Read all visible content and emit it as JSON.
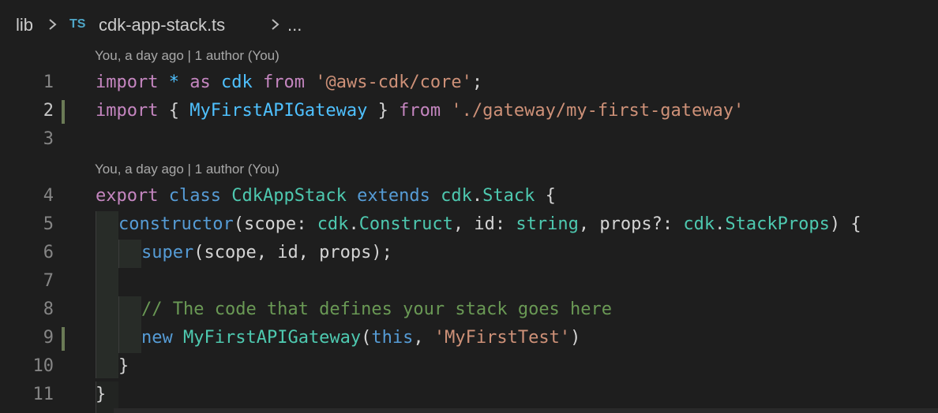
{
  "breadcrumb": {
    "folder": "lib",
    "file_icon": "TS",
    "file": "cdk-app-stack.ts",
    "more": "..."
  },
  "codelens": {
    "line1": "You, a day ago | 1 author (You)",
    "line4": "You, a day ago | 1 author (You)"
  },
  "line_numbers": [
    "1",
    "2",
    "3",
    "4",
    "5",
    "6",
    "7",
    "8",
    "9",
    "10",
    "11"
  ],
  "code": {
    "l1": {
      "import": "import",
      "star": "*",
      "as": "as",
      "cdk": "cdk",
      "from": "from",
      "module": "'@aws-cdk/core'",
      "semi": ";"
    },
    "l2": {
      "import": "import",
      "open": "{",
      "name": "MyFirstAPIGateway",
      "close": "}",
      "from": "from",
      "module": "'./gateway/my-first-gateway'"
    },
    "l4": {
      "export": "export",
      "class": "class",
      "name": "CdkAppStack",
      "extends": "extends",
      "cdk": "cdk",
      "dot": ".",
      "stack": "Stack",
      "brace": "{"
    },
    "l5": {
      "ctor": "constructor",
      "p1": "(",
      "scope": "scope",
      "c1": ":",
      "cdk1": "cdk",
      "dot1": ".",
      "construct": "Construct",
      "comma1": ",",
      "id": "id",
      "c2": ":",
      "string": "string",
      "comma2": ",",
      "props": "props",
      "opt": "?:",
      "cdk2": "cdk",
      "dot2": ".",
      "stackprops": "StackProps",
      "p2": ")",
      "brace": "{"
    },
    "l6": {
      "super": "super",
      "args": "(scope, id, props);"
    },
    "l8": {
      "comment": "// The code that defines your stack goes here"
    },
    "l9": {
      "new": "new",
      "name": "MyFirstAPIGateway",
      "p1": "(",
      "this": "this",
      "comma": ",",
      "str": "'MyFirstTest'",
      "p2": ")"
    },
    "l10": {
      "brace": "}"
    },
    "l11": {
      "brace": "}"
    }
  },
  "colors": {
    "background": "#1e1e1e",
    "keyword": "#c586c0",
    "storage": "#569cd6",
    "class": "#4ec9b0",
    "string": "#ce9178",
    "comment": "#6a9955",
    "modified_marker": "#6b7b56"
  }
}
